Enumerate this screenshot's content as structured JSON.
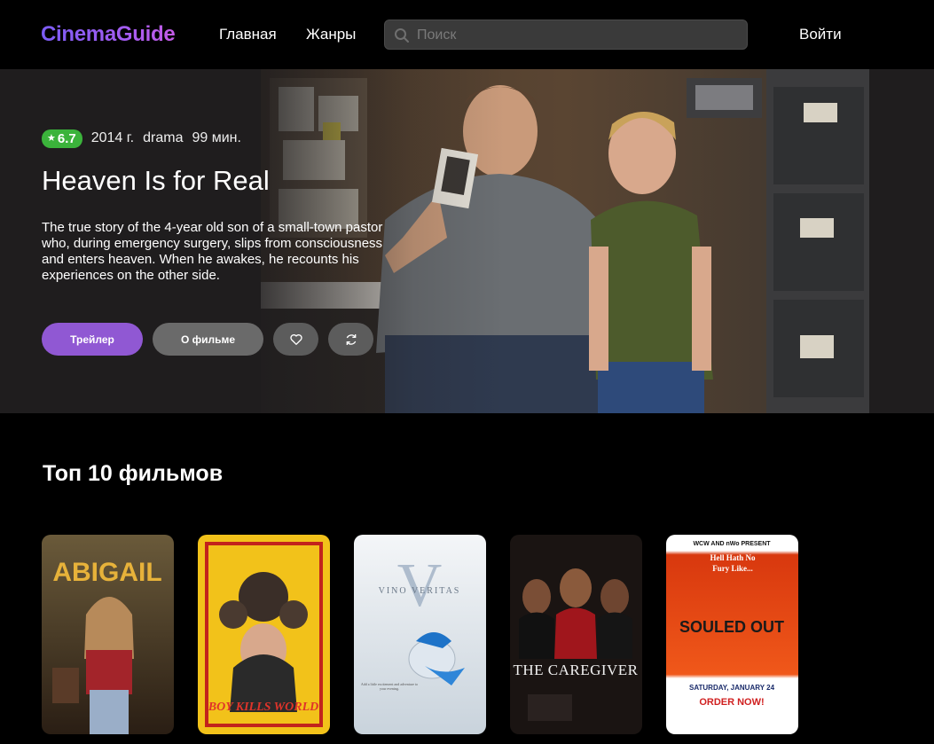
{
  "header": {
    "logo": "CinemaGuide",
    "nav": [
      {
        "label": "Главная"
      },
      {
        "label": "Жанры"
      }
    ],
    "search_placeholder": "Поиск",
    "login_label": "Войти"
  },
  "hero": {
    "rating": "6.7",
    "year": "2014 г.",
    "genre": "drama",
    "duration": "99 мин.",
    "title": "Heaven Is for Real",
    "description": "The true story of the 4-year old son of a small-town pastor who, during emergency surgery, slips from consciousness and enters heaven. When he awakes, he recounts his experiences on the other side.",
    "trailer_label": "Трейлер",
    "about_label": "О фильме",
    "rating_color": "#3bb33b",
    "accent_color": "#9058d3"
  },
  "top10": {
    "title": "Топ 10 фильмов",
    "posters": [
      {
        "title": "ABIGAIL"
      },
      {
        "title": "BOY KILLS WORLD"
      },
      {
        "title": "VINO VERITAS",
        "caption": "Add a little excitement and adventure to your evening."
      },
      {
        "title": "THE CAREGIVER"
      },
      {
        "title": "SOULED OUT",
        "top_line": "WCW AND nWo PRESENT",
        "tag_line": "Hell Hath No Fury Like...",
        "date_line": "SATURDAY, JANUARY 24",
        "cta": "ORDER NOW!"
      }
    ]
  }
}
